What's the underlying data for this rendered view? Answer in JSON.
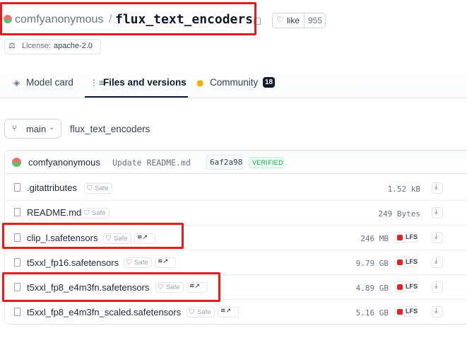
{
  "repo": {
    "org": "comfyanonymous",
    "separator": "/",
    "name": "flux_text_encoders",
    "like_label": "like",
    "like_count": "955",
    "license_label": "License:",
    "license_value": "apache-2.0"
  },
  "tabs": [
    {
      "label": "Model card",
      "icon": "model-card-icon"
    },
    {
      "label": "Files and versions",
      "icon": "files-icon",
      "active": true
    },
    {
      "label": "Community",
      "icon": "community-icon",
      "badge": "18"
    }
  ],
  "branch": {
    "label": "main",
    "path": "flux_text_encoders"
  },
  "commit": {
    "user": "comfyanonymous",
    "message": "Update README.md",
    "hash": "6af2a98",
    "verified": "VERIFIED"
  },
  "files": [
    {
      "name": ".gitattributes",
      "safe": "Safe",
      "size": "1.52 kB",
      "lfs": false,
      "stack": false
    },
    {
      "name": "README.md",
      "safe": "Safe",
      "size": "249 Bytes",
      "lfs": false,
      "stack": false
    },
    {
      "name": "clip_l.safetensors",
      "safe": "Safe",
      "size": "246 MB",
      "lfs": true,
      "stack": true
    },
    {
      "name": "t5xxl_fp16.safetensors",
      "safe": "Safe",
      "size": "9.79 GB",
      "lfs": true,
      "stack": true
    },
    {
      "name": "t5xxl_fp8_e4m3fn.safetensors",
      "safe": "Safe",
      "size": "4.89 GB",
      "lfs": true,
      "stack": true
    },
    {
      "name": "t5xxl_fp8_e4m3fn_scaled.safetensors",
      "safe": "Safe",
      "size": "5.16 GB",
      "lfs": true,
      "stack": true
    }
  ],
  "lfs_label": "LFS",
  "colors": {
    "highlight": "#e11d1d",
    "verified": "#16a34a",
    "lfs": "#dc2626"
  }
}
